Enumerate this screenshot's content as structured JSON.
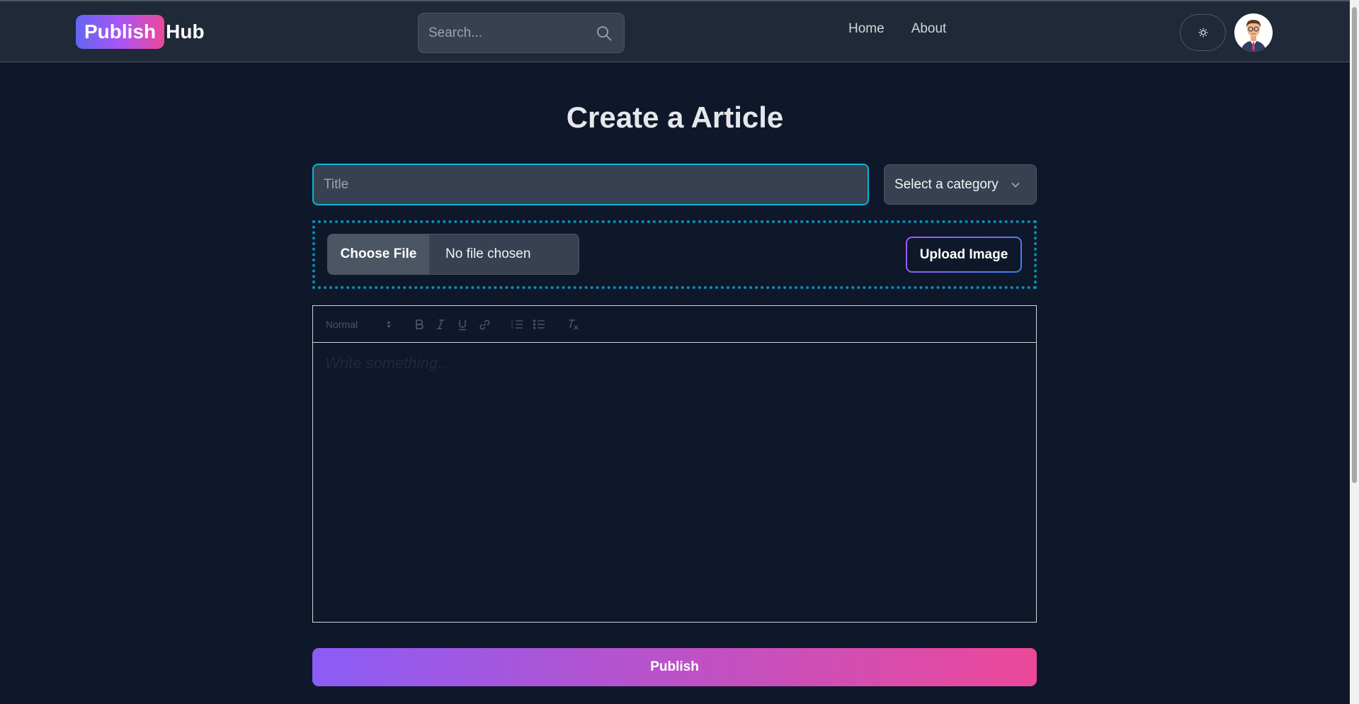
{
  "navbar": {
    "logo_primary": "Publish",
    "logo_secondary": "Hub",
    "search_placeholder": "Search...",
    "links": [
      {
        "label": "Home"
      },
      {
        "label": "About"
      }
    ],
    "theme_toggle_icon": "sun-icon"
  },
  "main": {
    "page_title": "Create a Article",
    "title_placeholder": "Title",
    "category_select_label": "Select a category",
    "file_choose_label": "Choose File",
    "file_status": "No file chosen",
    "upload_button_label": "Upload Image",
    "editor": {
      "heading_select": "Normal",
      "toolbar_icons": [
        "bold-icon",
        "italic-icon",
        "underline-icon",
        "link-icon",
        "ordered-list-icon",
        "bullet-list-icon",
        "clear-format-icon"
      ],
      "placeholder": "Write something..."
    },
    "publish_button_label": "Publish"
  },
  "colors": {
    "background": "#0f172a",
    "navbar": "#1f2937",
    "input": "#374151",
    "focus_ring": "#06b6d4",
    "gradient_start": "#8b5cf6",
    "gradient_end": "#ec4899"
  }
}
